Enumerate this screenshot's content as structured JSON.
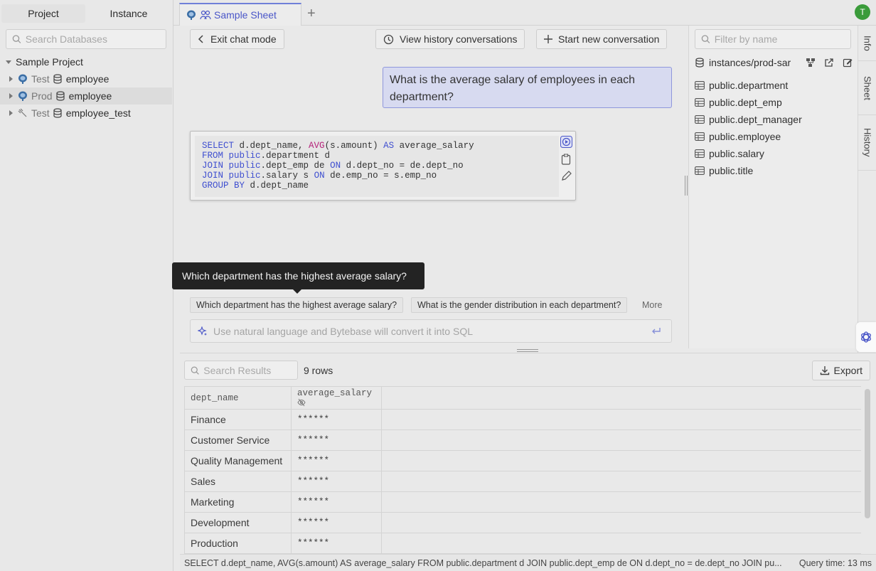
{
  "left_panel": {
    "tabs": [
      {
        "label": "Project"
      },
      {
        "label": "Instance"
      }
    ],
    "search_placeholder": "Search Databases",
    "project_name": "Sample Project",
    "databases": [
      {
        "env": "Test",
        "name": "employee",
        "icon": "postgres-icon"
      },
      {
        "env": "Prod",
        "name": "employee",
        "icon": "postgres-icon"
      },
      {
        "env": "Test",
        "name": "employee_test",
        "icon": "plug-icon"
      }
    ]
  },
  "tabs_bar": {
    "sheet_tab_label": "Sample Sheet",
    "add_tab": "+",
    "avatar_initial": "T"
  },
  "chat": {
    "exit_button": "Exit chat mode",
    "history_button": "View history conversations",
    "new_button": "Start new conversation",
    "user_message": "What is the average salary of employees in each department?",
    "sql_lines": [
      [
        {
          "t": "SELECT",
          "c": "kw"
        },
        {
          "t": " d.dept_name, ",
          "c": ""
        },
        {
          "t": "AVG",
          "c": "fn"
        },
        {
          "t": "(s.amount) ",
          "c": ""
        },
        {
          "t": "AS",
          "c": "kw"
        },
        {
          "t": " average_salary",
          "c": ""
        }
      ],
      [
        {
          "t": "FROM",
          "c": "kw"
        },
        {
          "t": " ",
          "c": ""
        },
        {
          "t": "public",
          "c": "kw"
        },
        {
          "t": ".department d",
          "c": ""
        }
      ],
      [
        {
          "t": "JOIN",
          "c": "kw"
        },
        {
          "t": " ",
          "c": ""
        },
        {
          "t": "public",
          "c": "kw"
        },
        {
          "t": ".dept_emp de ",
          "c": ""
        },
        {
          "t": "ON",
          "c": "kw"
        },
        {
          "t": " d.dept_no = de.dept_no",
          "c": ""
        }
      ],
      [
        {
          "t": "JOIN",
          "c": "kw"
        },
        {
          "t": " ",
          "c": ""
        },
        {
          "t": "public",
          "c": "kw"
        },
        {
          "t": ".salary s ",
          "c": ""
        },
        {
          "t": "ON",
          "c": "kw"
        },
        {
          "t": " de.emp_no = s.emp_no",
          "c": ""
        }
      ],
      [
        {
          "t": "GROUP BY",
          "c": "kw"
        },
        {
          "t": " d.dept_name",
          "c": ""
        }
      ]
    ],
    "tooltip": "Which department has the highest average salary?",
    "suggestions": [
      "Which department has the highest average salary?",
      "What is the gender distribution in each department?"
    ],
    "more_label": "More",
    "input_placeholder": "Use natural language and Bytebase will convert it into SQL"
  },
  "schema_panel": {
    "filter_placeholder": "Filter by name",
    "instance_path": "instances/prod-sar",
    "tables": [
      "public.department",
      "public.dept_emp",
      "public.dept_manager",
      "public.employee",
      "public.salary",
      "public.title"
    ]
  },
  "side_tabs": [
    "Info",
    "Sheet",
    "History"
  ],
  "results": {
    "search_placeholder": "Search Results",
    "row_count": "9 rows",
    "export_label": "Export",
    "columns": [
      "dept_name",
      "average_salary"
    ],
    "rows": [
      [
        "Finance",
        "******"
      ],
      [
        "Customer Service",
        "******"
      ],
      [
        "Quality Management",
        "******"
      ],
      [
        "Sales",
        "******"
      ],
      [
        "Marketing",
        "******"
      ],
      [
        "Development",
        "******"
      ],
      [
        "Production",
        "******"
      ]
    ]
  },
  "status_bar": {
    "query_text": "SELECT d.dept_name, AVG(s.amount) AS average_salary FROM public.department d JOIN public.dept_emp de ON d.dept_no = de.dept_no JOIN pu...",
    "query_time": "Query time: 13 ms"
  },
  "colors": {
    "accent": "#4a56c8",
    "user_msg_bg": "#d7daf0",
    "avatar": "#3a9b3a"
  }
}
